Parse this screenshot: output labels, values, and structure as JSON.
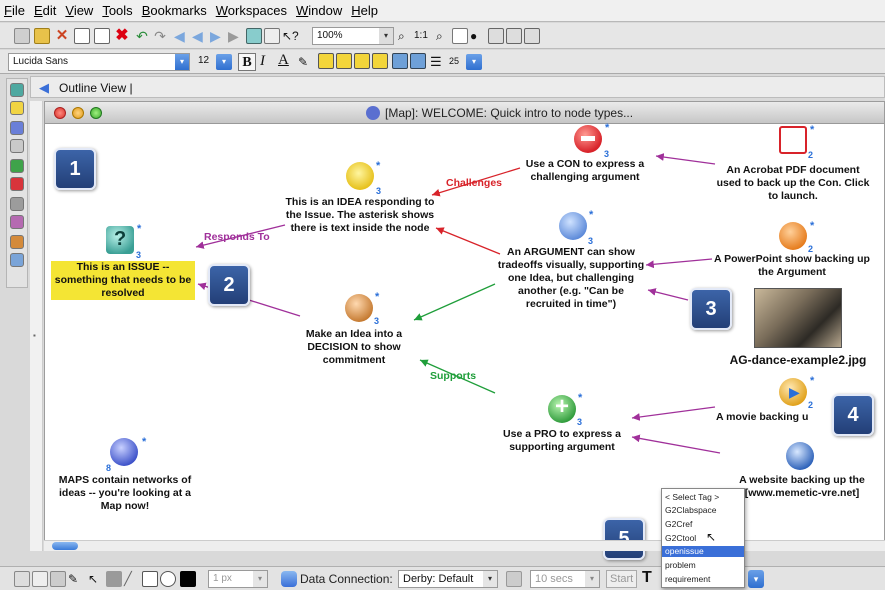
{
  "menu": [
    "File",
    "Edit",
    "View",
    "Tools",
    "Bookmarks",
    "Workspaces",
    "Window",
    "Help"
  ],
  "toolbar": {
    "zoom": "100%",
    "font": "Lucida Sans",
    "size": "12",
    "bold": "B",
    "italic": "I",
    "underline": "A",
    "line_spacing": "25"
  },
  "outline": {
    "label": "Outline View |"
  },
  "map": {
    "title": "[Map]: WELCOME: Quick intro to node types...",
    "nodes": {
      "con": "Use a CON to express a challenging argument",
      "con_count": "3",
      "pdf": "An Acrobat PDF document used to back up the Con. Click to launch.",
      "pdf_count": "2",
      "idea": "This is an IDEA responding to the Issue. The asterisk shows there is text inside the node",
      "idea_count": "3",
      "argument": "An ARGUMENT can show tradeoffs visually, supporting one Idea, but challenging another (e.g. \"Can be recruited in time\")",
      "argument_count": "3",
      "ppt": "A PowerPoint show backing up the Argument",
      "ppt_count": "2",
      "issue": "This is an ISSUE -- something that needs to be resolved",
      "issue_count": "3",
      "decision": "Make an Idea into a DECISION to show commitment",
      "decision_count": "3",
      "image": "AG-dance-example2.jpg",
      "pro": "Use a PRO to express a supporting argument",
      "pro_count": "3",
      "movie": "A movie backing u",
      "movie_count": "2",
      "maps": "MAPS contain networks of ideas -- you're looking at a Map now!",
      "maps_count": "8",
      "website": "A website backing up the [www.memetic-vre.net]"
    },
    "link_labels": {
      "challenges": "Challenges",
      "responds_to": "Responds To",
      "supports": "Supports"
    },
    "star": "*"
  },
  "callouts": [
    "1",
    "2",
    "3",
    "4",
    "5"
  ],
  "status": {
    "line_width": "1 px",
    "data_connection_label": "Data Connection:",
    "data_connection_value": "Derby: Default",
    "interval": "10 secs",
    "start": "Start",
    "text_tool": "T"
  },
  "tag_dropdown": {
    "options": [
      "< Select Tag >",
      "G2Clabspace",
      "G2Cref",
      "G2Ctool",
      "openissue",
      "problem",
      "requirement"
    ],
    "selected": "openissue"
  },
  "colors": {
    "challenge": "#d8232a",
    "support": "#1f9e3a",
    "respond": "#a0309a",
    "callout": "#2f4f8f",
    "issue_highlight": "#f4e534"
  }
}
